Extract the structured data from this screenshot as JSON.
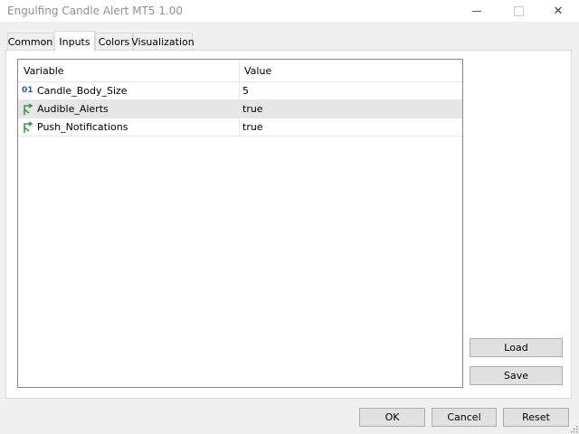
{
  "window": {
    "title": "Engulfing Candle Alert MT5 1.00",
    "close_glyph": "✕"
  },
  "tabs": [
    {
      "label": "Common"
    },
    {
      "label": "Inputs",
      "active": true
    },
    {
      "label": "Colors"
    },
    {
      "label": "Visualization"
    }
  ],
  "table": {
    "headers": {
      "variable": "Variable",
      "value": "Value"
    },
    "rows": [
      {
        "icon": "integer-icon",
        "icon_text": "01",
        "name": "Candle_Body_Size",
        "value": "5",
        "selected": false
      },
      {
        "icon": "boolean-icon",
        "name": "Audible_Alerts",
        "value": "true",
        "selected": true
      },
      {
        "icon": "boolean-icon",
        "name": "Push_Notifications",
        "value": "true",
        "selected": false
      }
    ]
  },
  "buttons": {
    "load": "Load",
    "save": "Save",
    "ok": "OK",
    "cancel": "Cancel",
    "reset": "Reset"
  },
  "colors": {
    "bool_icon": "#2e9b3c",
    "int_icon": "#1a5fb4",
    "selected_row": "#e6e6e6"
  }
}
